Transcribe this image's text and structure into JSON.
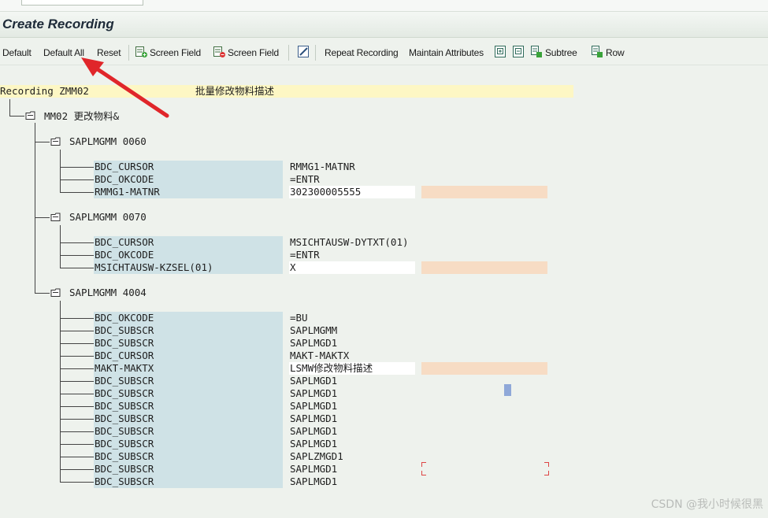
{
  "title": "Create Recording",
  "toolbar": {
    "default": "Default",
    "default_all": "Default All",
    "reset": "Reset",
    "screen_field_1": "Screen Field",
    "screen_field_2": "Screen Field",
    "repeat_recording": "Repeat Recording",
    "maintain_attributes": "Maintain Attributes",
    "subtree": "Subtree",
    "row": "Row"
  },
  "recording": {
    "label": "Recording ZMM02",
    "description": "批量修改物料描述",
    "transaction": "MM02 更改物料&"
  },
  "screens": [
    {
      "name": "SAPLMGMM 0060",
      "fields": [
        {
          "name": "BDC_CURSOR",
          "value": "RMMG1-MATNR"
        },
        {
          "name": "BDC_OKCODE",
          "value": "=ENTR"
        },
        {
          "name": "RMMG1-MATNR",
          "value": "302300005555"
        }
      ]
    },
    {
      "name": "SAPLMGMM 0070",
      "fields": [
        {
          "name": "BDC_CURSOR",
          "value": "MSICHTAUSW-DYTXT(01)"
        },
        {
          "name": "BDC_OKCODE",
          "value": "=ENTR"
        },
        {
          "name": "MSICHTAUSW-KZSEL(01)",
          "value": "X"
        }
      ]
    },
    {
      "name": "SAPLMGMM 4004",
      "fields": [
        {
          "name": "BDC_OKCODE",
          "value": "=BU"
        },
        {
          "name": "BDC_SUBSCR",
          "value": "SAPLMGMM"
        },
        {
          "name": "BDC_SUBSCR",
          "value": "SAPLMGD1"
        },
        {
          "name": "BDC_CURSOR",
          "value": "MAKT-MAKTX"
        },
        {
          "name": "MAKT-MAKTX",
          "value": "LSMW修改物料描述"
        },
        {
          "name": "BDC_SUBSCR",
          "value": "SAPLMGD1"
        },
        {
          "name": "BDC_SUBSCR",
          "value": "SAPLMGD1"
        },
        {
          "name": "BDC_SUBSCR",
          "value": "SAPLMGD1"
        },
        {
          "name": "BDC_SUBSCR",
          "value": "SAPLMGD1"
        },
        {
          "name": "BDC_SUBSCR",
          "value": "SAPLMGD1"
        },
        {
          "name": "BDC_SUBSCR",
          "value": "SAPLMGD1"
        },
        {
          "name": "BDC_SUBSCR",
          "value": "SAPLZMGD1"
        },
        {
          "name": "BDC_SUBSCR",
          "value": "SAPLMGD1"
        },
        {
          "name": "BDC_SUBSCR",
          "value": "SAPLMGD1"
        }
      ]
    }
  ],
  "watermark": "CSDN @我小时候很黑",
  "colors": {
    "recording_highlight": "#fdf7c4",
    "field_name_bg": "#cfe2e6",
    "input_highlight": "#f7dcc4",
    "annotation_arrow": "#e0262a"
  }
}
